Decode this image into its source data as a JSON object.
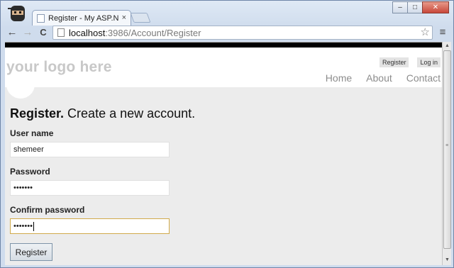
{
  "browser": {
    "tab_title": "Register - My ASP.NET MV",
    "tab_close": "×",
    "url_host": "localhost",
    "url_path": ":3986/Account/Register",
    "back_icon": "←",
    "forward_icon": "→",
    "reload_icon": "C",
    "star_icon": "☆",
    "menu_icon": "≡",
    "window_buttons": [
      "–",
      "□",
      "✕"
    ]
  },
  "site": {
    "logo": "your logo here",
    "login_links": [
      "Register",
      "Log in"
    ],
    "nav": [
      "Home",
      "About",
      "Contact"
    ]
  },
  "form": {
    "heading_strong": "Register.",
    "heading_rest": " Create a new account.",
    "username_label": "User name",
    "username_value": "shemeer",
    "password_label": "Password",
    "password_value": "•••••••",
    "confirm_label": "Confirm password",
    "confirm_value": "•••••••",
    "submit_label": "Register"
  },
  "colors": {
    "accent_focus": "#d1aa4a",
    "header_bar": "#000000"
  }
}
